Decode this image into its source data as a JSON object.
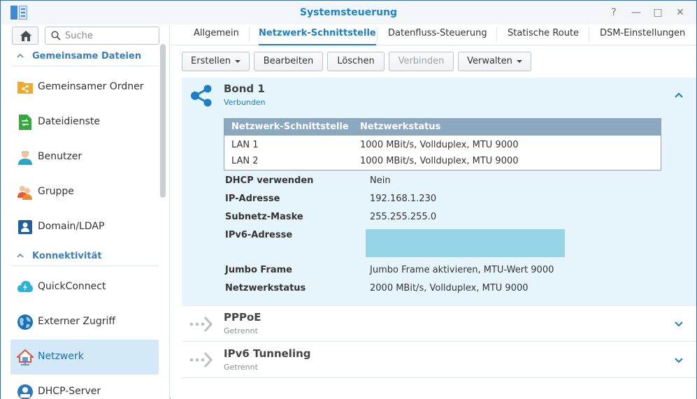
{
  "window": {
    "title": "Systemsteuerung",
    "controls": {
      "help": "?",
      "minimize": "—",
      "maximize": "□",
      "close": "✕"
    }
  },
  "sidebar": {
    "search_placeholder": "Suche",
    "sections": [
      {
        "label": "Gemeinsame Dateien"
      },
      {
        "label": "Konnektivität"
      }
    ],
    "items": [
      {
        "label": "Gemeinsamer Ordner",
        "icon": "shared-folder-icon"
      },
      {
        "label": "Dateidienste",
        "icon": "file-services-icon"
      },
      {
        "label": "Benutzer",
        "icon": "user-icon"
      },
      {
        "label": "Gruppe",
        "icon": "group-icon"
      },
      {
        "label": "Domain/LDAP",
        "icon": "domain-ldap-icon"
      },
      {
        "label": "QuickConnect",
        "icon": "quickconnect-icon"
      },
      {
        "label": "Externer Zugriff",
        "icon": "globe-icon"
      },
      {
        "label": "Netzwerk",
        "icon": "network-house-icon",
        "active": true
      },
      {
        "label": "DHCP-Server",
        "icon": "dhcp-server-icon"
      }
    ]
  },
  "tabs": [
    {
      "label": "Allgemein"
    },
    {
      "label": "Netzwerk-Schnittstelle",
      "active": true
    },
    {
      "label": "Datenfluss-Steuerung"
    },
    {
      "label": "Statische Route"
    },
    {
      "label": "DSM-Einstellungen"
    }
  ],
  "toolbar": {
    "create": "Erstellen",
    "edit": "Bearbeiten",
    "delete": "Löschen",
    "connect": "Verbinden",
    "manage": "Verwalten"
  },
  "interfaces": {
    "bond": {
      "name": "Bond 1",
      "status": "Verbunden",
      "table": {
        "headers": [
          "Netzwerk-Schnittstelle",
          "Netzwerkstatus"
        ],
        "rows": [
          [
            "LAN 1",
            "1000 MBit/s, Vollduplex, MTU 9000"
          ],
          [
            "LAN 2",
            "1000 MBit/s, Vollduplex, MTU 9000"
          ]
        ]
      },
      "details": [
        {
          "key": "DHCP verwenden",
          "value": "Nein"
        },
        {
          "key": "IP-Adresse",
          "value": "192.168.1.230"
        },
        {
          "key": "Subnetz-Maske",
          "value": "255.255.255.0"
        },
        {
          "key": "IPv6-Adresse",
          "value": ""
        },
        {
          "key": "Jumbo Frame",
          "value": "Jumbo Frame aktivieren, MTU-Wert 9000"
        },
        {
          "key": "Netzwerkstatus",
          "value": "2000 MBit/s, Vollduplex, MTU 9000"
        }
      ]
    },
    "pppoe": {
      "name": "PPPoE",
      "status": "Getrennt"
    },
    "ipv6tunnel": {
      "name": "IPv6 Tunneling",
      "status": "Getrennt"
    }
  },
  "colors": {
    "accent": "#1a7fc4",
    "panel_bg": "#e6f4fc",
    "table_header": "#8aa8bf",
    "redacted": "#96d5e8"
  }
}
